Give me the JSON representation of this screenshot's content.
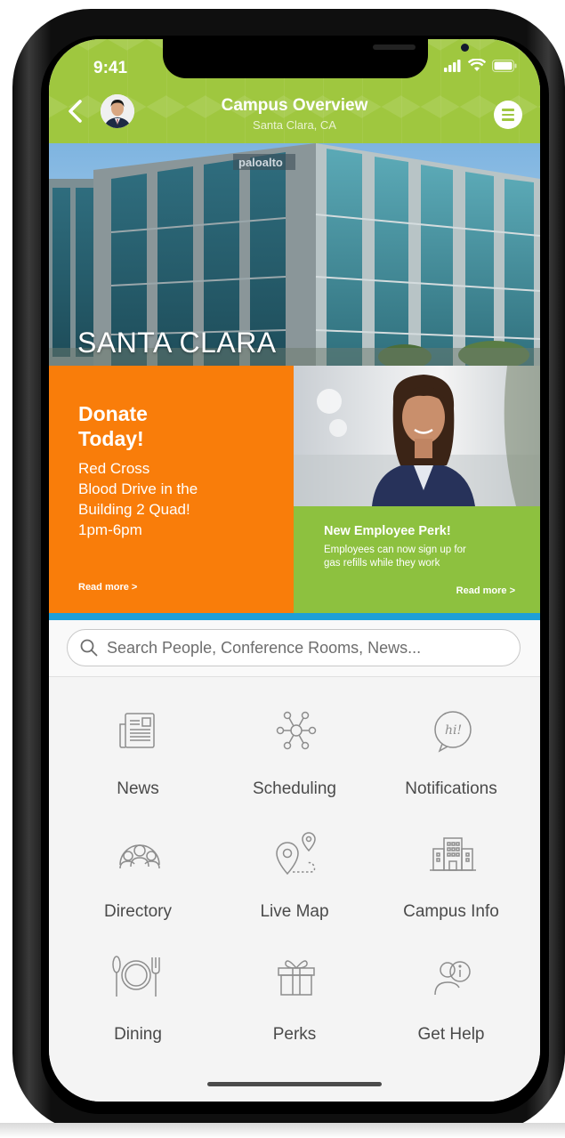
{
  "status": {
    "time": "9:41"
  },
  "header": {
    "title": "Campus Overview",
    "subtitle": "Santa Clara, CA"
  },
  "hero": {
    "title": "SANTA CLARA",
    "sign": "paloalto"
  },
  "promo_left": {
    "heading": "Donate\nToday!",
    "body": "Red Cross\nBlood Drive in the\nBuilding 2 Quad!\n1pm-6pm",
    "read_more": "Read more >"
  },
  "promo_right": {
    "heading": "New Employee Perk!",
    "body": "Employees can now sign up for\ngas refills while they work",
    "read_more": "Read more >"
  },
  "search": {
    "placeholder": "Search People, Conference Rooms, News..."
  },
  "tiles": [
    {
      "label": "News",
      "icon": "newspaper-icon"
    },
    {
      "label": "Scheduling",
      "icon": "network-icon"
    },
    {
      "label": "Notifications",
      "icon": "hi-bubble-icon"
    },
    {
      "label": "Directory",
      "icon": "people-group-icon"
    },
    {
      "label": "Live Map",
      "icon": "map-pin-route-icon"
    },
    {
      "label": "Campus Info",
      "icon": "building-icon"
    },
    {
      "label": "Dining",
      "icon": "plate-cutlery-icon"
    },
    {
      "label": "Perks",
      "icon": "gift-icon"
    },
    {
      "label": "Get Help",
      "icon": "help-person-icon"
    }
  ],
  "colors": {
    "header": "#9fc73f",
    "promo_orange": "#f97d0a",
    "promo_green": "#8dc13f",
    "accent_blue": "#1e9fd8"
  }
}
